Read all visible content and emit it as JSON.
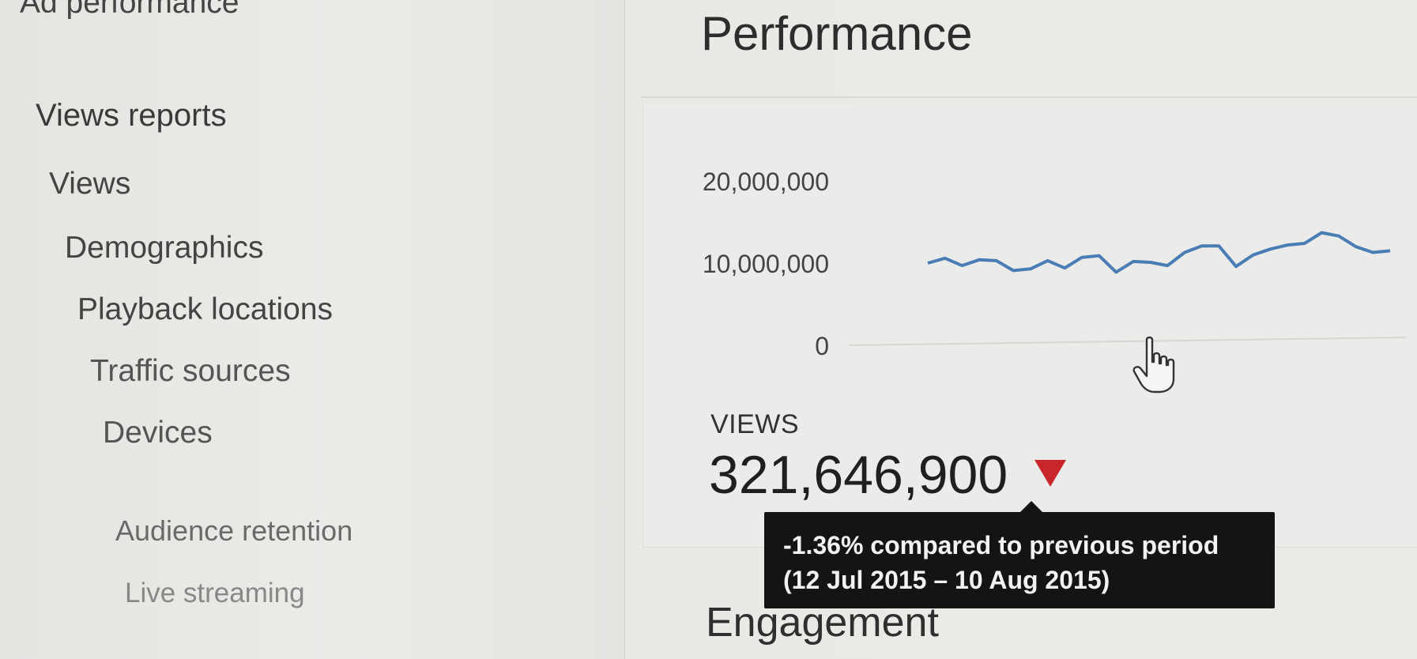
{
  "sidebar": {
    "cut_off_item": "Ad performance",
    "heading": "Views reports",
    "items": [
      {
        "label": "Views"
      },
      {
        "label": "Demographics"
      },
      {
        "label": "Playback locations"
      },
      {
        "label": "Traffic sources"
      },
      {
        "label": "Devices"
      },
      {
        "label": "Audience retention"
      },
      {
        "label": "Live streaming"
      }
    ]
  },
  "main": {
    "title": "Performance",
    "metric": {
      "label": "VIEWS",
      "value": "321,646,900",
      "trend": "down",
      "trend_color": "#c8262b"
    },
    "tooltip": {
      "line1": "-1.36% compared to previous period",
      "line2": "(12 Jul 2015 – 10 Aug 2015)"
    },
    "next_section": "Engagement"
  },
  "chart_data": {
    "type": "line",
    "title": "",
    "xlabel": "",
    "ylabel": "",
    "ylim": [
      0,
      20000000
    ],
    "y_ticks": [
      "20,000,000",
      "10,000,000",
      "0"
    ],
    "y_tick_values": [
      20000000,
      10000000,
      0
    ],
    "line_color": "#4a7db5",
    "x": [
      1,
      2,
      3,
      4,
      5,
      6,
      7,
      8,
      9,
      10,
      11,
      12,
      13,
      14,
      15,
      16,
      17,
      18,
      19,
      20,
      21,
      22,
      23,
      24,
      25,
      26,
      27,
      28,
      29,
      30
    ],
    "values": [
      10000000,
      10600000,
      9700000,
      10400000,
      10300000,
      9100000,
      9300000,
      10300000,
      9400000,
      10700000,
      10900000,
      8900000,
      10200000,
      10100000,
      9700000,
      11300000,
      12100000,
      12100000,
      9600000,
      11000000,
      11700000,
      12200000,
      12400000,
      13700000,
      13300000,
      12000000,
      11300000,
      11500000
    ]
  }
}
